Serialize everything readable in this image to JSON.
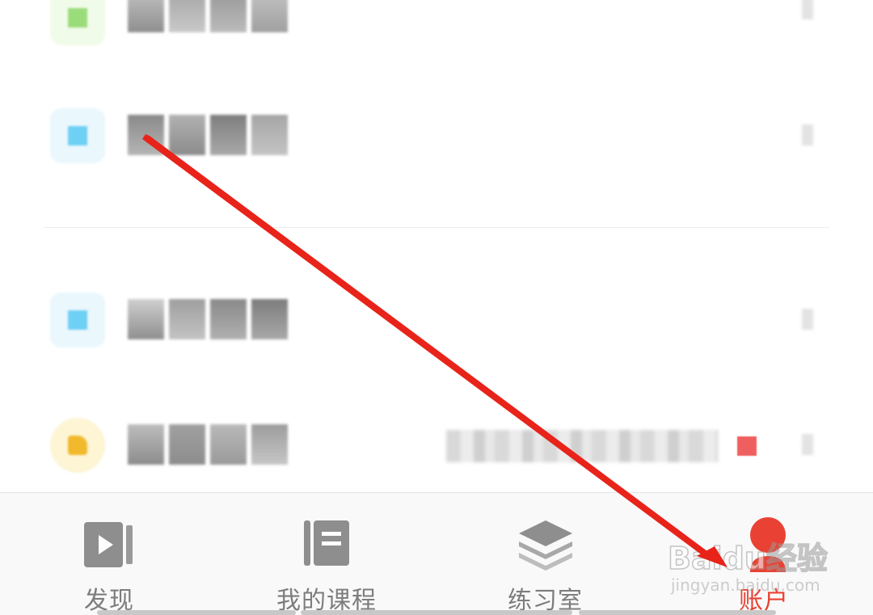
{
  "menu_rows": [
    {
      "icon": "green-square-icon"
    },
    {
      "icon": "blue-square-icon"
    },
    {
      "icon": "blue-square-icon"
    },
    {
      "icon": "yellow-circle-icon"
    }
  ],
  "tabbar": {
    "tabs": [
      {
        "label": "发现",
        "icon": "play-video-icon",
        "active": false
      },
      {
        "label": "我的课程",
        "icon": "book-icon",
        "active": false
      },
      {
        "label": "练习室",
        "icon": "layers-stack-icon",
        "active": false
      },
      {
        "label": "账户",
        "icon": "account-icon",
        "active": true
      }
    ]
  },
  "watermark": {
    "main": "Baidu经验",
    "sub": "jingyan.baidu.com"
  },
  "colors": {
    "accent": "#e94234",
    "inactive_tab": "#7d7d7d",
    "arrow": "#e8231a",
    "tabbar_bg": "#f9f9f9"
  }
}
